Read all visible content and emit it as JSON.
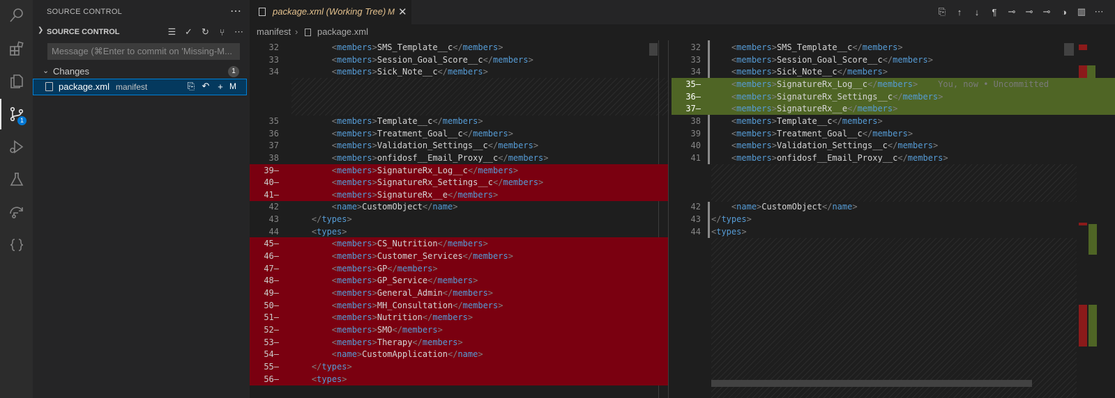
{
  "activity_bar": {
    "items": [
      {
        "name": "search-icon"
      },
      {
        "name": "extensions-icon"
      },
      {
        "name": "explorer-icon"
      },
      {
        "name": "source-control-icon",
        "badge": "1"
      },
      {
        "name": "run-debug-icon"
      },
      {
        "name": "testing-icon"
      },
      {
        "name": "remote-icon"
      },
      {
        "name": "braces-icon"
      }
    ]
  },
  "sidebar": {
    "title": "SOURCE CONTROL",
    "section_title": "SOURCE CONTROL",
    "message_placeholder": "Message (⌘Enter to commit on 'Missing-M...",
    "changes_label": "Changes",
    "changes_count": "1",
    "file": {
      "name": "package.xml",
      "dir": "manifest",
      "status": "M"
    }
  },
  "editor": {
    "tab_title": "package.xml (Working Tree)",
    "tab_status": "M",
    "breadcrumb": [
      "manifest",
      "package.xml"
    ],
    "blame_text": "You, now • Uncommitted",
    "left_lines": [
      {
        "n": "32",
        "t": "members",
        "v": "SMS_Template__c",
        "k": "normal"
      },
      {
        "n": "33",
        "t": "members",
        "v": "Session_Goal_Score__c",
        "k": "normal"
      },
      {
        "n": "34",
        "t": "members",
        "v": "Sick_Note__c",
        "k": "normal"
      },
      {
        "n": "35",
        "t": "members",
        "v": "Template__c",
        "k": "normal"
      },
      {
        "n": "36",
        "t": "members",
        "v": "Treatment_Goal__c",
        "k": "normal"
      },
      {
        "n": "37",
        "t": "members",
        "v": "Validation_Settings__c",
        "k": "normal"
      },
      {
        "n": "38",
        "t": "members",
        "v": "onfidosf__Email_Proxy__c",
        "k": "normal"
      },
      {
        "n": "39",
        "t": "members",
        "v": "SignatureRx_Log__c",
        "k": "del"
      },
      {
        "n": "40",
        "t": "members",
        "v": "SignatureRx_Settings__c",
        "k": "del"
      },
      {
        "n": "41",
        "t": "members",
        "v": "SignatureRx__e",
        "k": "del"
      },
      {
        "n": "42",
        "t": "name",
        "v": "CustomObject",
        "k": "normal"
      },
      {
        "n": "43",
        "close": "types",
        "k": "normal"
      },
      {
        "n": "44",
        "open": "types",
        "k": "normal"
      },
      {
        "n": "45",
        "t": "members",
        "v": "CS_Nutrition",
        "k": "del"
      },
      {
        "n": "46",
        "t": "members",
        "v": "Customer_Services",
        "k": "del"
      },
      {
        "n": "47",
        "t": "members",
        "v": "GP",
        "k": "del"
      },
      {
        "n": "48",
        "t": "members",
        "v": "GP_Service",
        "k": "del"
      },
      {
        "n": "49",
        "t": "members",
        "v": "General_Admin",
        "k": "del"
      },
      {
        "n": "50",
        "t": "members",
        "v": "MH_Consultation",
        "k": "del"
      },
      {
        "n": "51",
        "t": "members",
        "v": "Nutrition",
        "k": "del"
      },
      {
        "n": "52",
        "t": "members",
        "v": "SMO",
        "k": "del"
      },
      {
        "n": "53",
        "t": "members",
        "v": "Therapy",
        "k": "del"
      },
      {
        "n": "54",
        "t": "name",
        "v": "CustomApplication",
        "k": "del"
      },
      {
        "n": "55",
        "close": "types",
        "k": "del"
      },
      {
        "n": "56",
        "open": "types",
        "k": "del"
      }
    ],
    "right_lines": [
      {
        "n": "32",
        "t": "members",
        "v": "SMS_Template__c",
        "k": "normal"
      },
      {
        "n": "33",
        "t": "members",
        "v": "Session_Goal_Score__c",
        "k": "normal"
      },
      {
        "n": "34",
        "t": "members",
        "v": "Sick_Note__c",
        "k": "normal"
      },
      {
        "n": "35",
        "t": "members",
        "v": "SignatureRx_Log__c",
        "k": "ins"
      },
      {
        "n": "36",
        "t": "members",
        "v": "SignatureRx_Settings__c",
        "k": "ins"
      },
      {
        "n": "37",
        "t": "members",
        "v": "SignatureRx__e",
        "k": "ins"
      },
      {
        "n": "38",
        "t": "members",
        "v": "Template__c",
        "k": "normal"
      },
      {
        "n": "39",
        "t": "members",
        "v": "Treatment_Goal__c",
        "k": "normal"
      },
      {
        "n": "40",
        "t": "members",
        "v": "Validation_Settings__c",
        "k": "normal"
      },
      {
        "n": "41",
        "t": "members",
        "v": "onfidosf__Email_Proxy__c",
        "k": "normal"
      },
      {
        "n": "42",
        "t": "name",
        "v": "CustomObject",
        "k": "normal"
      },
      {
        "n": "43",
        "close": "types",
        "k": "normal"
      },
      {
        "n": "44",
        "open": "types",
        "k": "normal"
      }
    ]
  },
  "colors": {
    "deleted": "#7a0010",
    "inserted": "#4f6525",
    "accent": "#007fd4",
    "modified": "#e2c08d"
  }
}
